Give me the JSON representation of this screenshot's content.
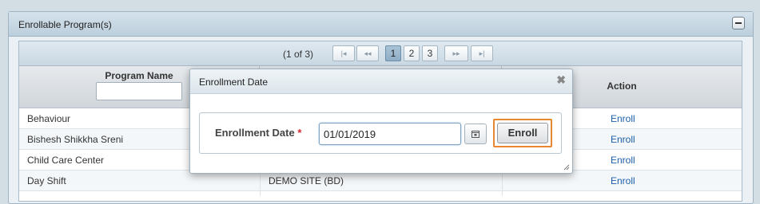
{
  "panel": {
    "title": "Enrollable Program(s)",
    "collapse_icon": "minus-icon"
  },
  "paginator": {
    "info": "(1 of 3)",
    "first_icon": "first-page-icon",
    "prev_icon": "prev-page-icon",
    "pages": [
      "1",
      "2",
      "3"
    ],
    "active_page": "1",
    "next_icon": "next-page-icon",
    "last_icon": "last-page-icon"
  },
  "table": {
    "columns": [
      "Program Name",
      "",
      "Action"
    ],
    "filter_placeholder": "",
    "rows": [
      {
        "program": "Behaviour",
        "site": "",
        "action": "Enroll"
      },
      {
        "program": "Bishesh Shikkha Sreni",
        "site": "",
        "action": "Enroll"
      },
      {
        "program": "Child Care Center",
        "site": "",
        "action": "Enroll"
      },
      {
        "program": "Day Shift",
        "site": "DEMO SITE (BD)",
        "action": "Enroll"
      }
    ]
  },
  "dialog": {
    "title": "Enrollment Date",
    "close_icon": "close-icon",
    "field_label": "Enrollment Date",
    "required_mark": "*",
    "date_value": "01/01/2019",
    "calendar_icon": "calendar-icon",
    "enroll_label": "Enroll",
    "highlight_color": "#e8872d"
  }
}
